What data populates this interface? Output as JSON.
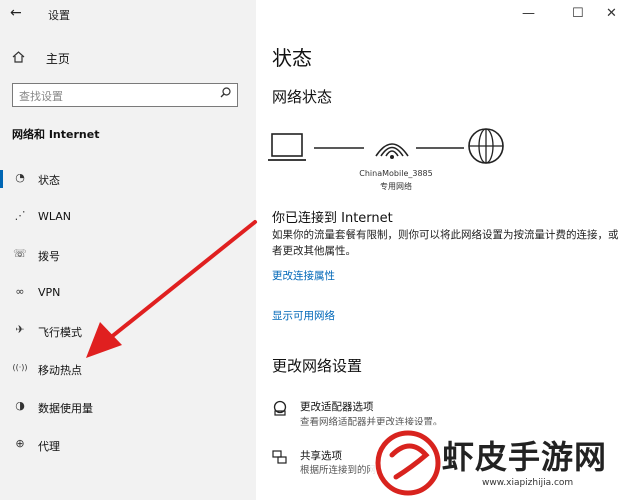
{
  "window": {
    "title": "设置",
    "back_glyph": "←",
    "minimize_glyph": "—",
    "maximize_glyph": "☐",
    "close_glyph": "✕"
  },
  "sidebar": {
    "home_label": "主页",
    "search_placeholder": "查找设置",
    "section_title": "网络和 Internet",
    "items": [
      {
        "label": "状态",
        "icon": "status-icon",
        "glyph": "◔"
      },
      {
        "label": "WLAN",
        "icon": "wifi-icon",
        "glyph": "⋰"
      },
      {
        "label": "拨号",
        "icon": "dialup-icon",
        "glyph": "☏"
      },
      {
        "label": "VPN",
        "icon": "vpn-icon",
        "glyph": "∞"
      },
      {
        "label": "飞行模式",
        "icon": "airplane-icon",
        "glyph": "✈"
      },
      {
        "label": "移动热点",
        "icon": "hotspot-icon",
        "glyph": "((·))"
      },
      {
        "label": "数据使用量",
        "icon": "data-usage-icon",
        "glyph": "◑"
      },
      {
        "label": "代理",
        "icon": "proxy-icon",
        "glyph": "⊕"
      }
    ]
  },
  "main": {
    "title": "状态",
    "network_status_heading": "网络状态",
    "network_name": "ChinaMobile_3885",
    "network_type": "专用网络",
    "connected_title": "你已连接到 Internet",
    "connected_desc": "如果你的流量套餐有限制，则你可以将此网络设置为按流量计费的连接，或者更改其他属性。",
    "link_change_props": "更改连接属性",
    "link_show_networks": "显示可用网络",
    "change_settings_heading": "更改网络设置",
    "adapter_title": "更改适配器选项",
    "adapter_desc": "查看网络适配器并更改连接设置。",
    "sharing_title": "共享选项",
    "sharing_desc": "根据所连接到的网"
  },
  "watermark": {
    "text": "虾皮手游网",
    "url": "www.xiapizhijia.com"
  },
  "colors": {
    "accent": "#0067b8",
    "arrow": "#e02020",
    "sidebar_bg": "#f2f2f2"
  }
}
